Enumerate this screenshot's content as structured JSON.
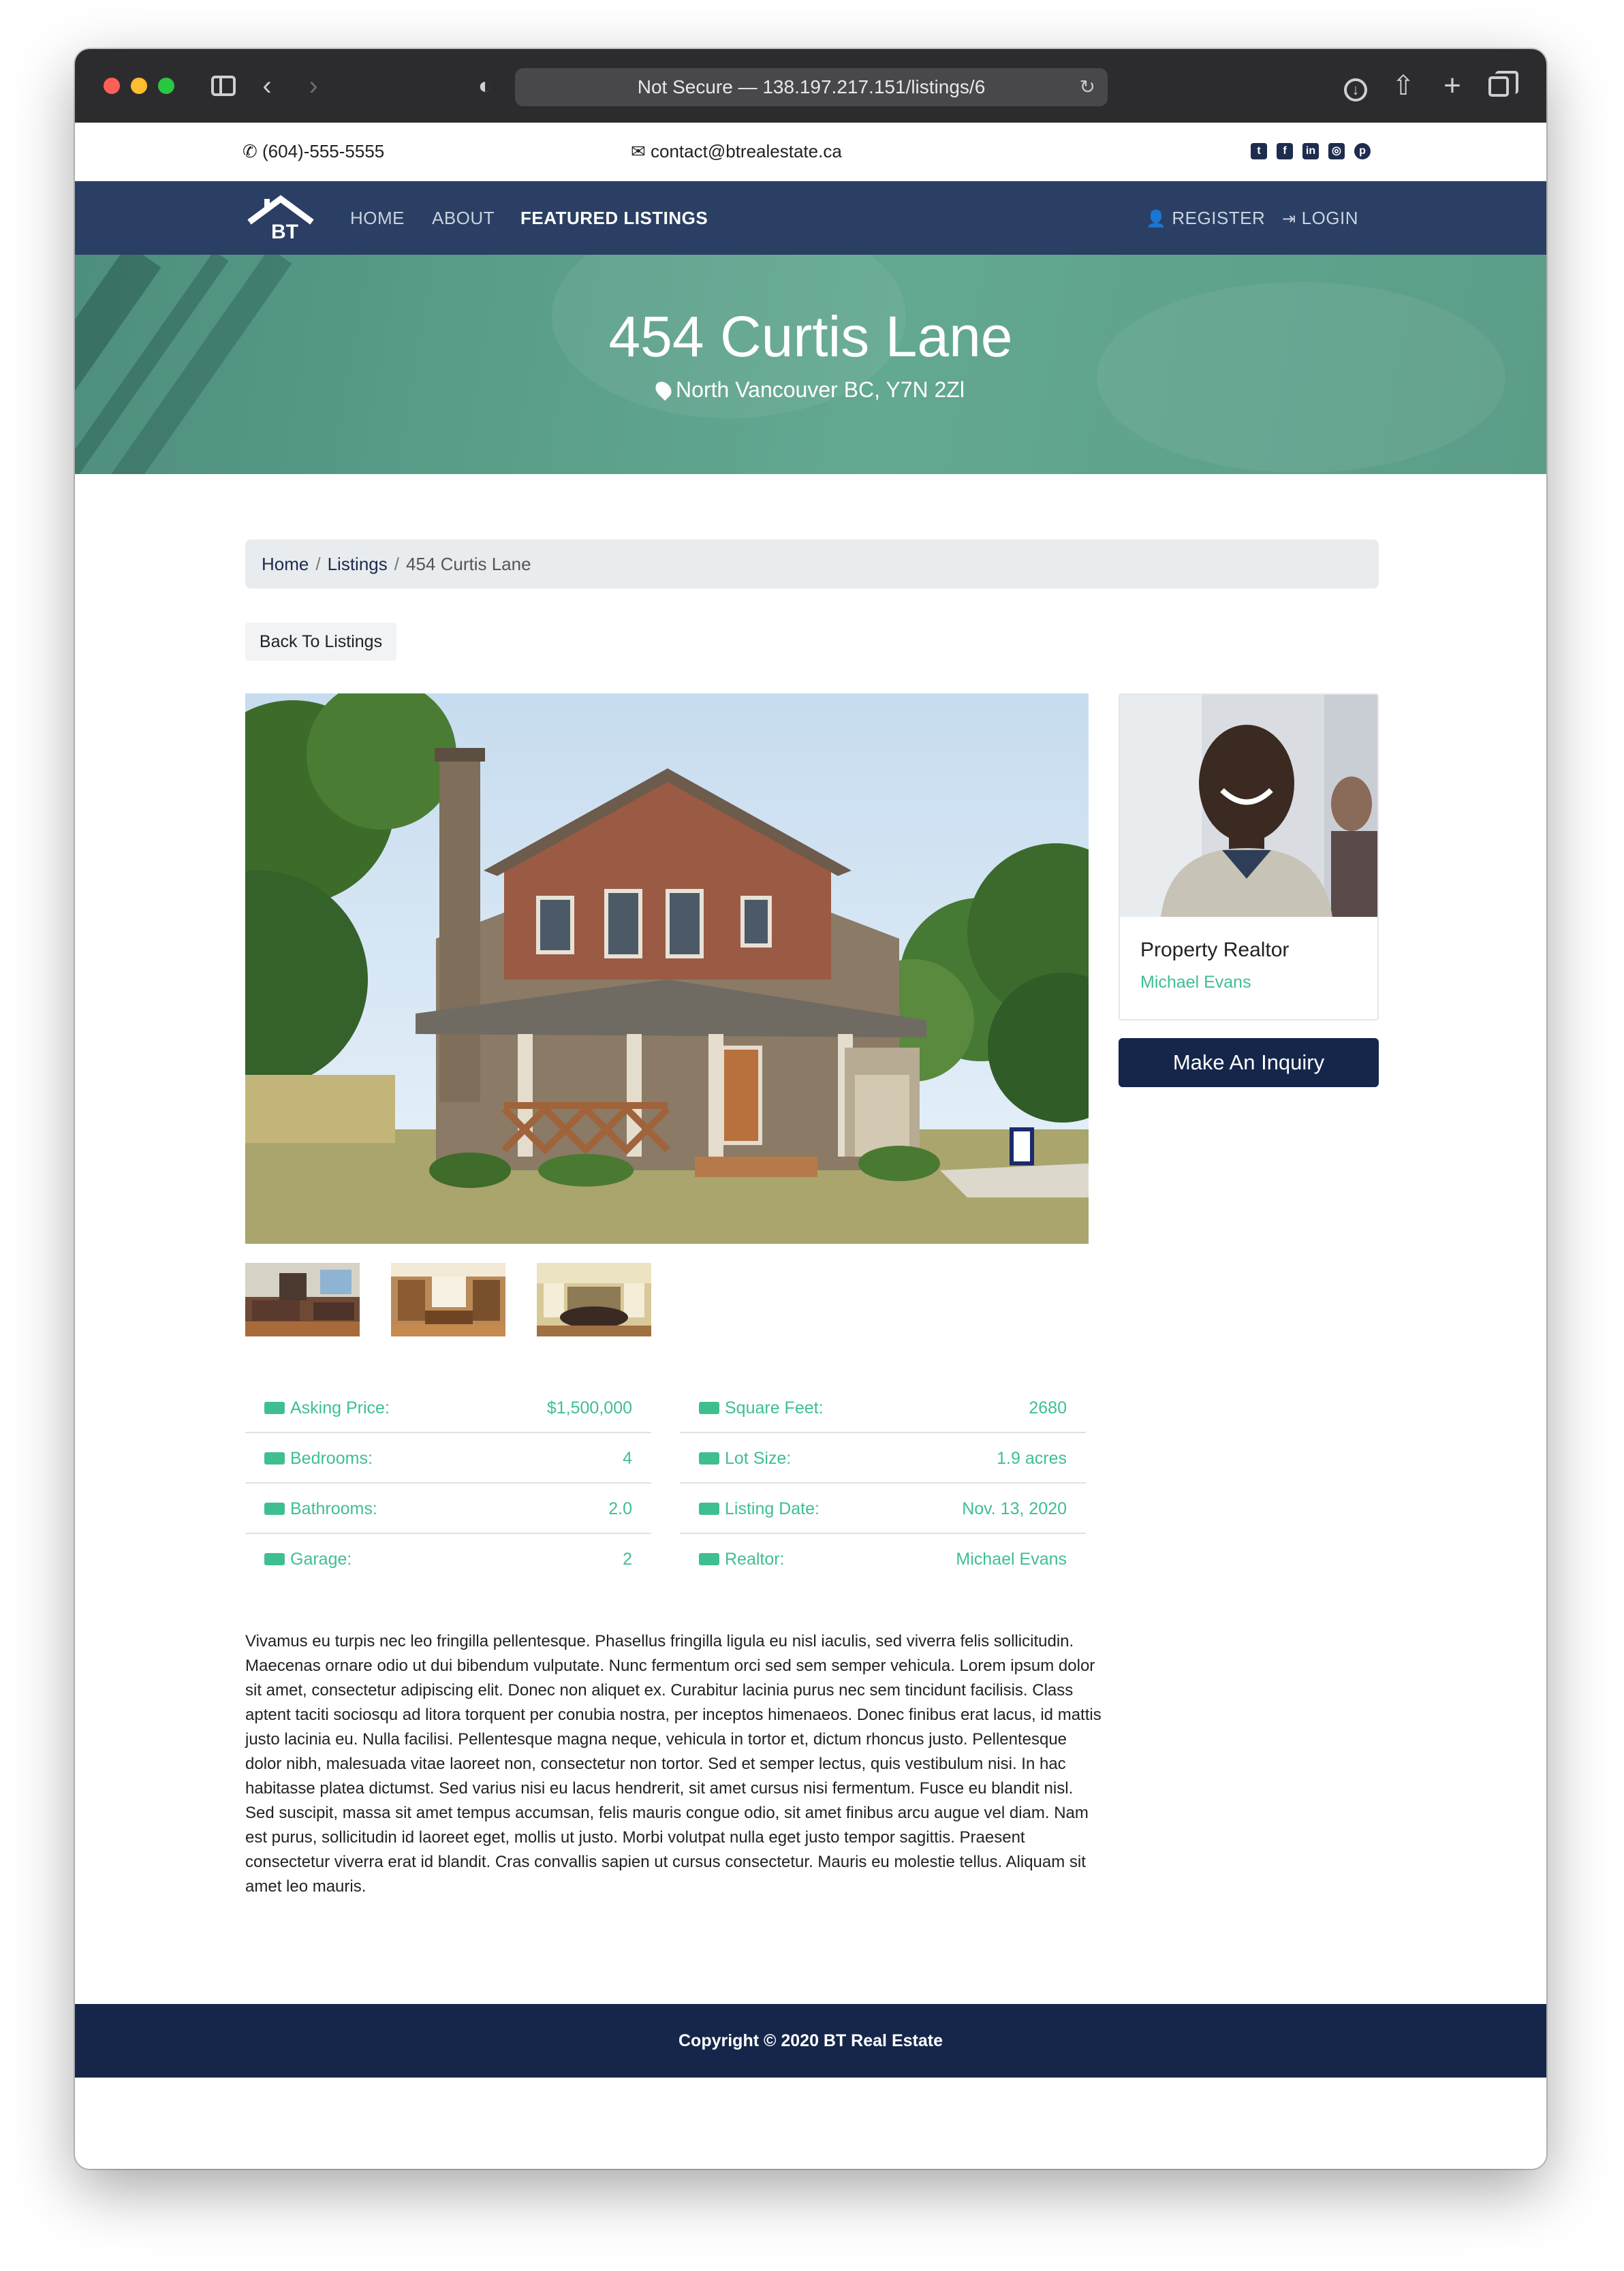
{
  "browser": {
    "url_text": "Not Secure — 138.197.217.151/listings/6"
  },
  "topbar": {
    "phone": "(604)-555-5555",
    "email": "contact@btrealestate.ca",
    "social_icons": [
      "twitter-icon",
      "facebook-icon",
      "linkedin-icon",
      "instagram-icon",
      "pinterest-icon"
    ]
  },
  "navbar": {
    "logo_text": "BT",
    "links": [
      "HOME",
      "ABOUT",
      "FEATURED LISTINGS"
    ],
    "register": "REGISTER",
    "login": "LOGIN"
  },
  "hero": {
    "title": "454 Curtis Lane",
    "location": "North Vancouver BC, Y7N 2Zl"
  },
  "breadcrumb": {
    "home": "Home",
    "listings": "Listings",
    "current": "454 Curtis Lane"
  },
  "back_button": "Back To Listings",
  "realtor": {
    "title": "Property Realtor",
    "name": "Michael Evans"
  },
  "inquiry_button": "Make An Inquiry",
  "details_left": [
    {
      "label": "Asking Price:",
      "value": "$1,500,000"
    },
    {
      "label": "Bedrooms:",
      "value": "4"
    },
    {
      "label": "Bathrooms:",
      "value": "2.0"
    },
    {
      "label": "Garage:",
      "value": "2"
    }
  ],
  "details_right": [
    {
      "label": "Square Feet:",
      "value": "2680"
    },
    {
      "label": "Lot Size:",
      "value": "1.9 acres"
    },
    {
      "label": "Listing Date:",
      "value": "Nov. 13, 2020"
    },
    {
      "label": "Realtor:",
      "value": "Michael Evans"
    }
  ],
  "description": "Vivamus eu turpis nec leo fringilla pellentesque. Phasellus fringilla ligula eu nisl iaculis, sed viverra felis sollicitudin. Maecenas ornare odio ut dui bibendum vulputate. Nunc fermentum orci sed sem semper vehicula. Lorem ipsum dolor sit amet, consectetur adipiscing elit. Donec non aliquet ex. Curabitur lacinia purus nec sem tincidunt facilisis. Class aptent taciti sociosqu ad litora torquent per conubia nostra, per inceptos himenaeos. Donec finibus erat lacus, id mattis justo lacinia eu. Nulla facilisi. Pellentesque magna neque, vehicula in tortor et, dictum rhoncus justo. Pellentesque dolor nibh, malesuada vitae laoreet non, consectetur non tortor. Sed et semper lectus, quis vestibulum nisi. In hac habitasse platea dictumst. Sed varius nisi eu lacus hendrerit, sit amet cursus nisi fermentum. Fusce eu blandit nisl. Sed suscipit, massa sit amet tempus accumsan, felis mauris congue odio, sit amet finibus arcu augue vel diam. Nam est purus, sollicitudin id laoreet eget, mollis ut justo. Morbi volutpat nulla eget justo tempor sagittis. Praesent consectetur viverra erat id blandit. Cras convallis sapien ut cursus consectetur. Mauris eu molestie tellus. Aliquam sit amet leo mauris.",
  "footer": "Copyright © 2020 BT Real Estate",
  "colors": {
    "navbar": "#2a3f63",
    "footer": "#15264a",
    "accent_green": "#3fbf8f",
    "hero": "#5a9e8a"
  }
}
